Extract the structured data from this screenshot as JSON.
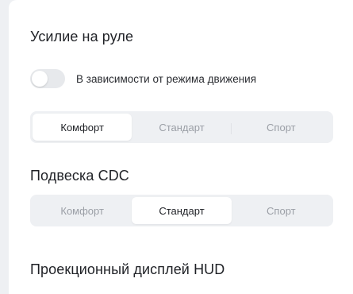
{
  "steering": {
    "title": "Усилие на руле",
    "toggle_label": "В зависимости от режима движения",
    "toggle_on": false,
    "options": [
      "Комфорт",
      "Стандарт",
      "Спорт"
    ],
    "selected": 0
  },
  "suspension": {
    "title": "Подвеска CDC",
    "options": [
      "Комфорт",
      "Стандарт",
      "Спорт"
    ],
    "selected": 1
  },
  "hud": {
    "title": "Проекционный дисплей HUD"
  }
}
